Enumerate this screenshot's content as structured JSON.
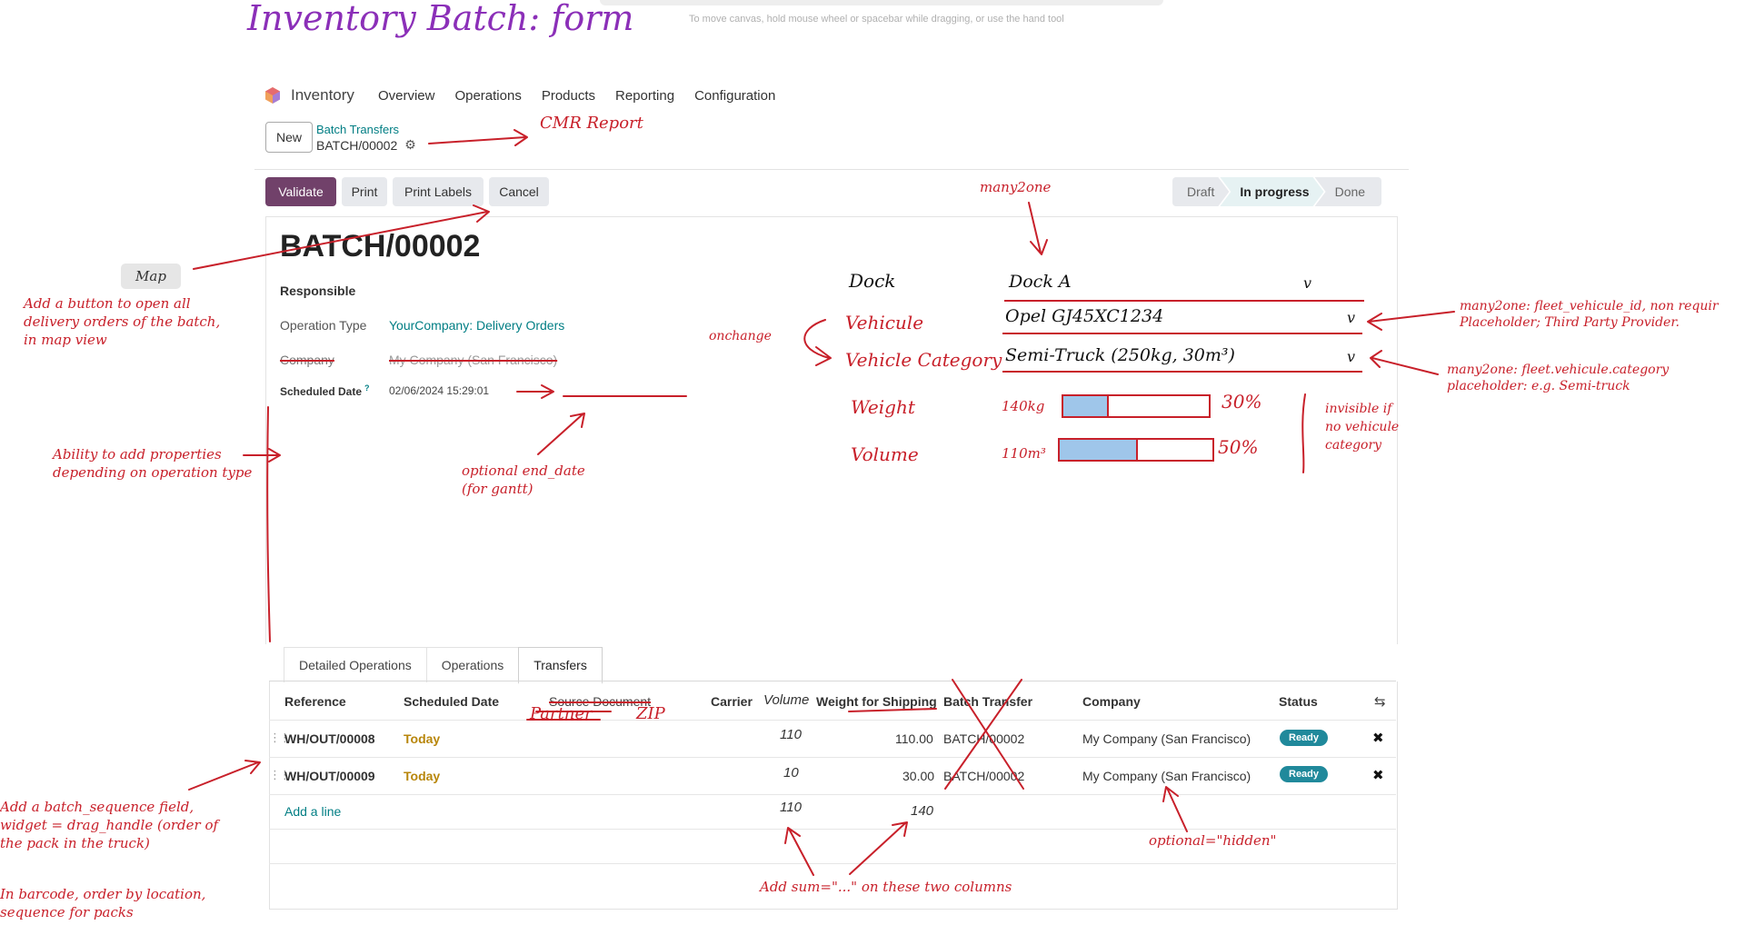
{
  "page_title": "Inventory Batch: form",
  "canvas_hint": "To move canvas, hold mouse wheel or spacebar while dragging, or use the hand tool",
  "nav": {
    "app": "Inventory",
    "items": [
      "Overview",
      "Operations",
      "Products",
      "Reporting",
      "Configuration"
    ]
  },
  "breadcrumb": {
    "new_label": "New",
    "parent": "Batch Transfers",
    "current": "BATCH/00002"
  },
  "actions": {
    "validate": "Validate",
    "print": "Print",
    "print_labels": "Print Labels",
    "cancel": "Cancel"
  },
  "statusbar": [
    "Draft",
    "In progress",
    "Done"
  ],
  "form": {
    "name": "BATCH/00002",
    "responsible_label": "Responsible",
    "operation_type_label": "Operation Type",
    "operation_type_value": "YourCompany: Delivery Orders",
    "company_label": "Company",
    "company_value": "My Company (San Francisco)",
    "scheduled_label": "Scheduled Date",
    "scheduled_help": "?",
    "scheduled_value": "02/06/2024 15:29:01"
  },
  "mock_fields": {
    "dock_label": "Dock",
    "dock_value": "Dock A",
    "vehicle_label": "Vehicule",
    "vehicle_value": "Opel GJ45XC1234",
    "category_label": "Vehicle Category",
    "category_value": "Semi-Truck (250kg, 30m³)",
    "weight_label": "Weight",
    "weight_value": "140kg",
    "weight_pct": "30%",
    "weight_fill": 0.3,
    "volume_label": "Volume",
    "volume_value": "110m³",
    "volume_pct": "50%",
    "volume_fill": 0.5,
    "dropdown_glyph": "v"
  },
  "tabs": [
    "Detailed Operations",
    "Operations",
    "Transfers"
  ],
  "table": {
    "headers": [
      "Reference",
      "Scheduled Date",
      "Source Document",
      "Carrier",
      "Volume",
      "Weight for Shipping",
      "Batch Transfer",
      "Company",
      "Status"
    ],
    "added_headers": [
      "Partner",
      "ZIP"
    ],
    "rows": [
      {
        "reference": "WH/OUT/00008",
        "date": "Today",
        "volume": "110",
        "weight": "110.00",
        "batch": "BATCH/00002",
        "company": "My Company (San Francisco)",
        "status": "Ready"
      },
      {
        "reference": "WH/OUT/00009",
        "date": "Today",
        "volume": "10",
        "weight": "30.00",
        "batch": "BATCH/00002",
        "company": "My Company (San Francisco)",
        "status": "Ready"
      }
    ],
    "add_line": "Add a line",
    "sum_volume": "110",
    "sum_weight": "140"
  },
  "annotations": {
    "cmr": "CMR Report",
    "map": "Map",
    "map_note": [
      "Add a button to open all",
      "delivery orders of the batch,",
      "in map view"
    ],
    "many2one": "many2one",
    "onchange": "onchange",
    "vehicle_note": [
      "many2one: fleet_vehicule_id, non requir",
      "Placeholder; Third Party Provider."
    ],
    "category_note": [
      "many2one: fleet.vehicule.category",
      "placeholder: e.g. Semi-truck"
    ],
    "invisible_note": [
      "invisible if",
      "no vehicule",
      "category"
    ],
    "properties_note": [
      "Ability to add properties",
      "depending on operation type"
    ],
    "end_date_note": [
      "optional end_date",
      "(for gantt)"
    ],
    "sequence_note": [
      "Add a batch_sequence field,",
      "widget = drag_handle (order of",
      "the pack in the truck)"
    ],
    "barcode_note": [
      "In barcode, order by location,",
      "sequence for packs"
    ],
    "optional_hidden": "optional=\"hidden\"",
    "sum_note": "Add sum=\"...\" on these two columns"
  },
  "colors": {
    "primary": "#71416a",
    "teal": "#017e84",
    "annotation": "#c8202a",
    "title": "#8b2fb8",
    "badge": "#20899b"
  }
}
